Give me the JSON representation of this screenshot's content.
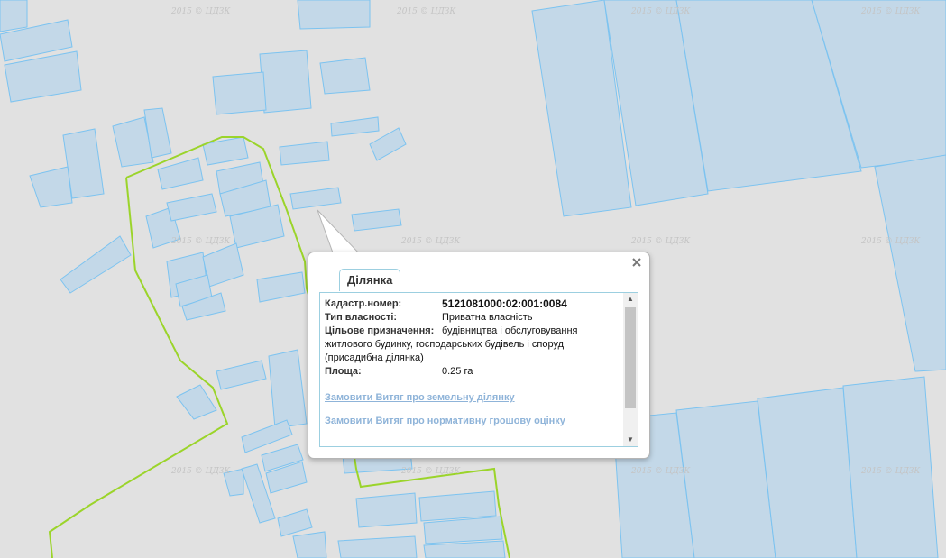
{
  "watermark": "2015 © ЦДЗК",
  "colors": {
    "background": "#e1e1e1",
    "parcel_fill": "#c3d8e8",
    "parcel_stroke": "#7cc3f0",
    "boundary": "#9bd42a"
  },
  "popup": {
    "tab_label": "Ділянка",
    "close_icon": "close-icon",
    "fields": [
      {
        "label": "Кадастр.номер:",
        "value": "5121081000:02:001:0084"
      },
      {
        "label": "Тип власності:",
        "value": "Приватна власність"
      },
      {
        "label": "Цільове призначення:",
        "value": "будівництва і обслуговування"
      },
      {
        "label": "Площа:",
        "value": "0.25 га"
      }
    ],
    "purpose_continuation": "житлового будинку, господарських будівель і споруд (присадибна ділянка)",
    "links": [
      "Замовити Витяг про земельну ділянку",
      "Замовити Витяг про нормативну грошову оцінку"
    ]
  }
}
